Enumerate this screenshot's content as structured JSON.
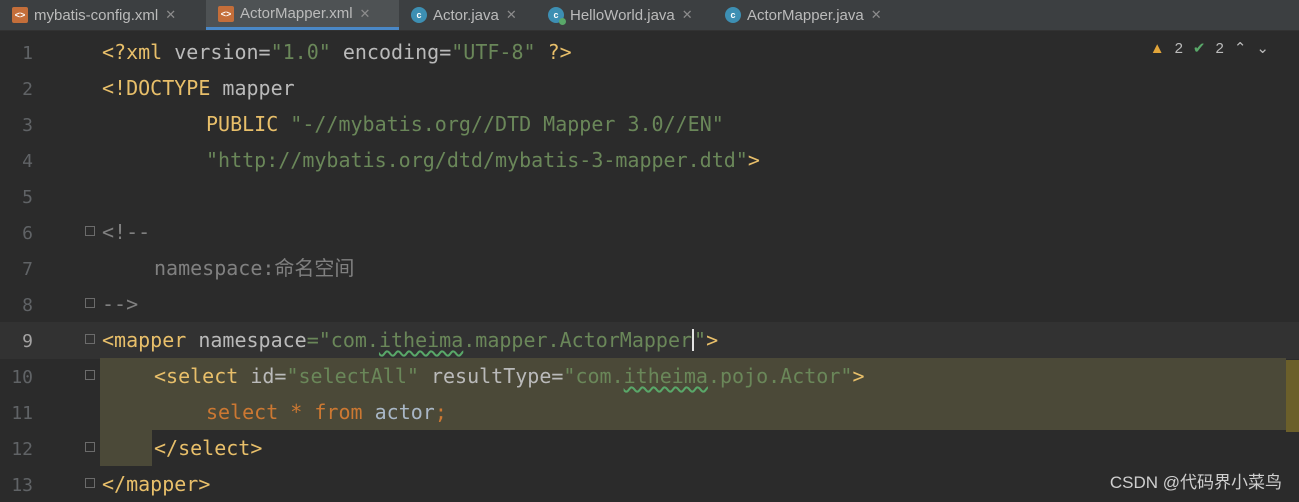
{
  "tabs": [
    {
      "label": "mybatis-config.xml",
      "icon": "xml-file-icon",
      "active": false
    },
    {
      "label": "ActorMapper.xml",
      "icon": "xml-file-icon",
      "active": true
    },
    {
      "label": "Actor.java",
      "icon": "java-class-icon",
      "active": false
    },
    {
      "label": "HelloWorld.java",
      "icon": "java-runnable-class-icon",
      "active": false
    },
    {
      "label": "ActorMapper.java",
      "icon": "java-class-icon",
      "active": false
    }
  ],
  "inspection": {
    "warnings": "2",
    "ok": "2"
  },
  "line_numbers": [
    "1",
    "2",
    "3",
    "4",
    "5",
    "6",
    "7",
    "8",
    "9",
    "10",
    "11",
    "12",
    "13"
  ],
  "code": {
    "l1": {
      "a": "<?xml ",
      "b": "version",
      "c": "=",
      "d": "\"1.0\"",
      "e": " encoding",
      "f": "=",
      "g": "\"UTF-8\"",
      "h": " ?>"
    },
    "l2": {
      "a": "<!DOCTYPE ",
      "b": "mapper"
    },
    "l3": {
      "a": "PUBLIC ",
      "b": "\"-//mybatis.org//DTD Mapper 3.0//EN\""
    },
    "l4": {
      "a": "\"http://mybatis.org/dtd/mybatis-3-mapper.dtd\"",
      "b": ">"
    },
    "l6": {
      "a": "<!--"
    },
    "l7": {
      "a": "namespace:命名空间"
    },
    "l8": {
      "a": "-->"
    },
    "l9": {
      "a": "<mapper ",
      "b": "namespace",
      "c": "=\"",
      "d": "com.",
      "e": "itheima",
      ".f": ".mapper.ActorMapper",
      "g": "\"",
      ">": ">"
    },
    "l10": {
      "a": "<select ",
      "b": "id",
      "c": "=",
      "d": "\"selectAll\"",
      "e": " resultType",
      "f": "=",
      "g": "\"com.",
      "h": "itheima",
      "i": ".pojo.Actor\"",
      "j": ">"
    },
    "l11": {
      "a": "select ",
      "b": "* ",
      "c": "from ",
      "d": "actor",
      ";": ";"
    },
    "l12": {
      "a": "</select>"
    },
    "l13": {
      "a": "</mapper>"
    }
  },
  "colors": {
    "background": "#2b2b2b",
    "tag": "#e8bf6a",
    "value": "#6a8759",
    "keyword": "#cc7832",
    "comment": "#808080"
  },
  "watermark": "CSDN @代码界小菜鸟"
}
